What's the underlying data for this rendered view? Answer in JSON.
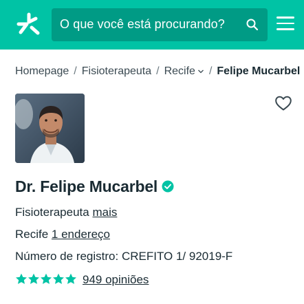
{
  "header": {
    "brand_color": "#00c3a5",
    "search": {
      "placeholder": "O que você está procurando?",
      "icon": "search-icon"
    },
    "logo_icon": "doctoralia-logo-icon",
    "menu_icon": "hamburger-menu-icon"
  },
  "breadcrumb": {
    "items": [
      "Homepage",
      "Fisioterapeuta",
      "Recife",
      "Felipe Mucarbel"
    ],
    "separator": "/"
  },
  "profile": {
    "name": "Dr. Felipe Mucarbel",
    "verified_icon": "verified-check-icon",
    "specialty": "Fisioterapeuta",
    "specialty_more": "mais",
    "city": "Recife",
    "addresses_link": "1 endereço",
    "registration": "Número de registro: CREFITO 1/ 92019-F",
    "rating_stars": 5,
    "reviews_link": "949 opiniões",
    "star_color": "#00c3a5",
    "favorite_icon": "heart-outline-icon"
  }
}
